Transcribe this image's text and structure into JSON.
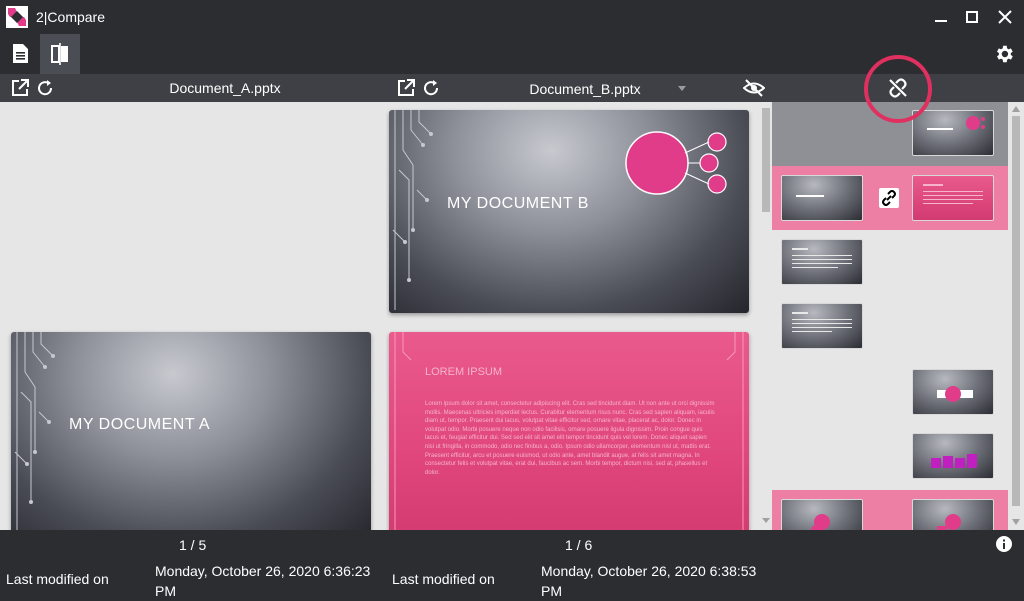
{
  "app": {
    "title": "2|Compare",
    "accent": "#e03c8a",
    "highlight_ring": "#e03060"
  },
  "window": {
    "minimize": "minimize-icon",
    "maximize": "maximize-icon",
    "close": "close-icon"
  },
  "toolbar": {
    "documents_icon": "documents-icon",
    "compare_icon": "compare-icon",
    "settings_icon": "gear-icon"
  },
  "left_doc": {
    "filename": "Document_A.pptx",
    "page": "1 / 5",
    "modified_label": "Last modified on",
    "modified_value": "Monday, October 26, 2020 6:36:23 PM"
  },
  "right_doc": {
    "filename": "Document_B.pptx",
    "page": "1 / 6",
    "modified_label": "Last modified on",
    "modified_value": "Monday, October 26, 2020 6:38:53 PM"
  },
  "slides": {
    "a1_title": "MY DOCUMENT A",
    "b1_title": "MY DOCUMENT B",
    "b2_title": "LOREM IPSUM",
    "b2_body": "Lorem ipsum dolor sit amet, consectetur adipiscing elit. Cras sed tincidunt diam. Ut non ante ut orci dignissim mollis. Maecenas ultricies imperdiet lectus. Curabitur elementum risus nunc. Cras sed sapien aliquam, iaculis diam ut, tempor. Praesent dui lacus, volutpat vitae efficitur sed, ornare vitae, placerat ac, dolor. Donec in volutpat odio. Morbi posuere neque non odio facilisis, ornare posuere ligula dignissim. Proin congue quis lacus et, feugiat efficitur dui. Sed sed elit sit amet elit tempor tincidunt quis vel lorem. Donec aliquet sapien nisi ut fringilla, in commodo, odio nec finibus a, odio. Ipsum odio ullamcorper, elementum nisl ut, mattis erat. Praesent efficitur, arcu et posuere euismod, ut odio ante, amet blandit augue, at felis sit amet magna. In consectetur felis et volutpat vitae, erat dui, faucibus ac sem. Morbi tempor, dictum nisi, sed at, phasellus et dolor."
  },
  "thumbnails": {
    "link_icon": "link-icon",
    "unlink_icon": "unlink-icon",
    "right_first_title": "MY DOCUMENT B",
    "left_first_title": "MY DOCUMENT A"
  },
  "status": {
    "info_icon": "info-icon"
  }
}
